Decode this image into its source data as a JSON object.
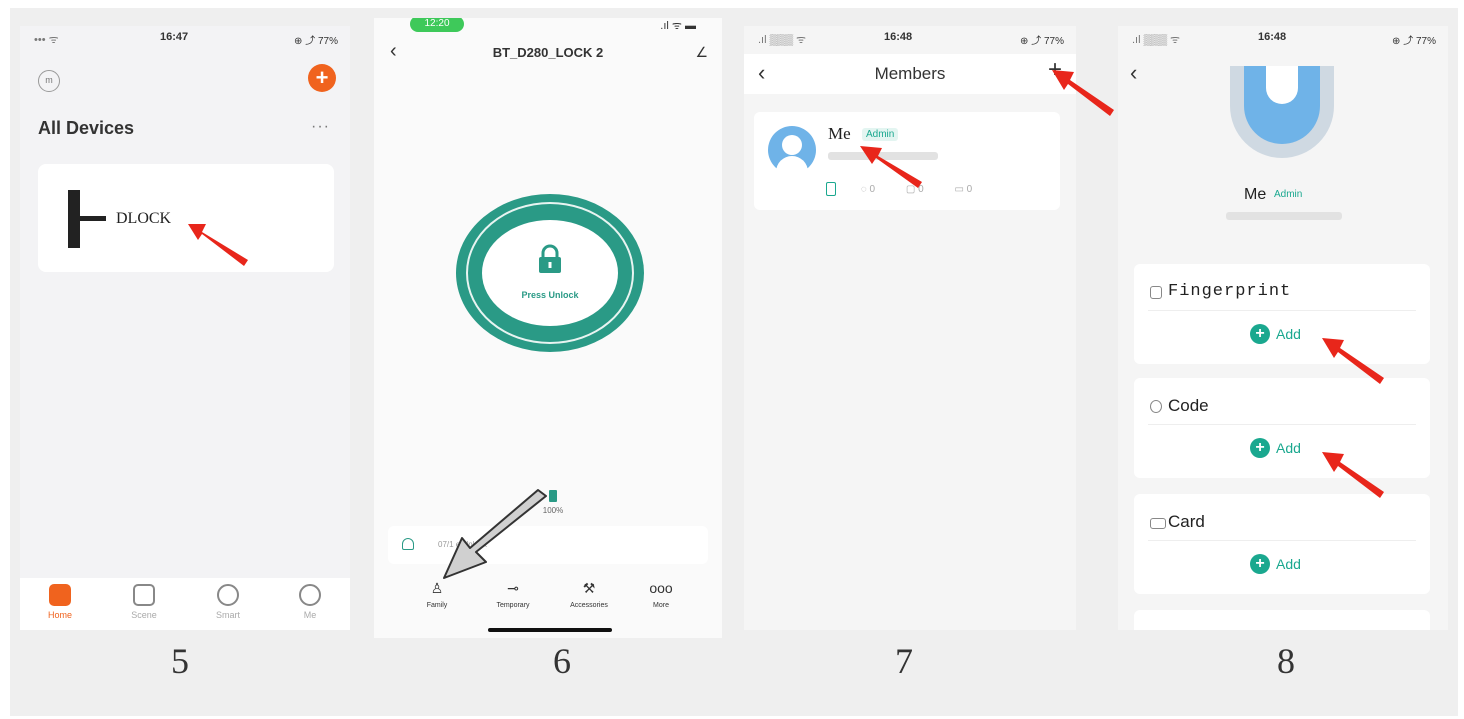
{
  "steps": [
    "5",
    "6",
    "7",
    "8"
  ],
  "screen5": {
    "status_time": "16:47",
    "status_right": "⊕ ⤴ 77%",
    "title": "All Devices",
    "more": "···",
    "device_name": "DLOCK",
    "tabs": [
      {
        "label": "Home",
        "active": true
      },
      {
        "label": "Scene",
        "active": false
      },
      {
        "label": "Smart",
        "active": false
      },
      {
        "label": "Me",
        "active": false
      }
    ],
    "accent": "#f0631e"
  },
  "screen6": {
    "status_time": "12:20",
    "title": "BT_D280_LOCK 2",
    "unlock_label": "Press Unlock",
    "battery": "100%",
    "log_text": "07/1 e Unlock",
    "tabs": [
      "Family",
      "Temporary",
      "Accessories",
      "More"
    ],
    "accent": "#2a9a86"
  },
  "screen7": {
    "status_time": "16:48",
    "status_right": "⊕ ⤴ 77%",
    "title": "Members",
    "member_name": "Me",
    "member_badge": "Admin",
    "counts": [
      "0",
      "0",
      "0"
    ]
  },
  "screen8": {
    "status_time": "16:48",
    "status_right": "⊕ ⤴ 77%",
    "me_name": "Me",
    "me_badge": "Admin",
    "sections": [
      {
        "title": "Fingerprint",
        "add": "Add"
      },
      {
        "title": "Code",
        "add": "Add"
      },
      {
        "title": "Card",
        "add": "Add"
      }
    ],
    "accent": "#1aa88f"
  },
  "annotation_color": "#e8261b"
}
